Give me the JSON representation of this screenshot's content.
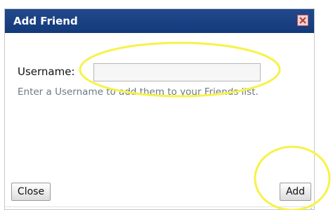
{
  "dialog": {
    "title": "Add Friend",
    "close_icon": "close-x-icon",
    "username_label": "Username:",
    "username_value": "",
    "help_text": "Enter a Username to add them to your Friends list.",
    "close_button": "Close",
    "add_button": "Add"
  },
  "colors": {
    "titlebar": "#1b428a",
    "annotation": "#f7f24a"
  }
}
